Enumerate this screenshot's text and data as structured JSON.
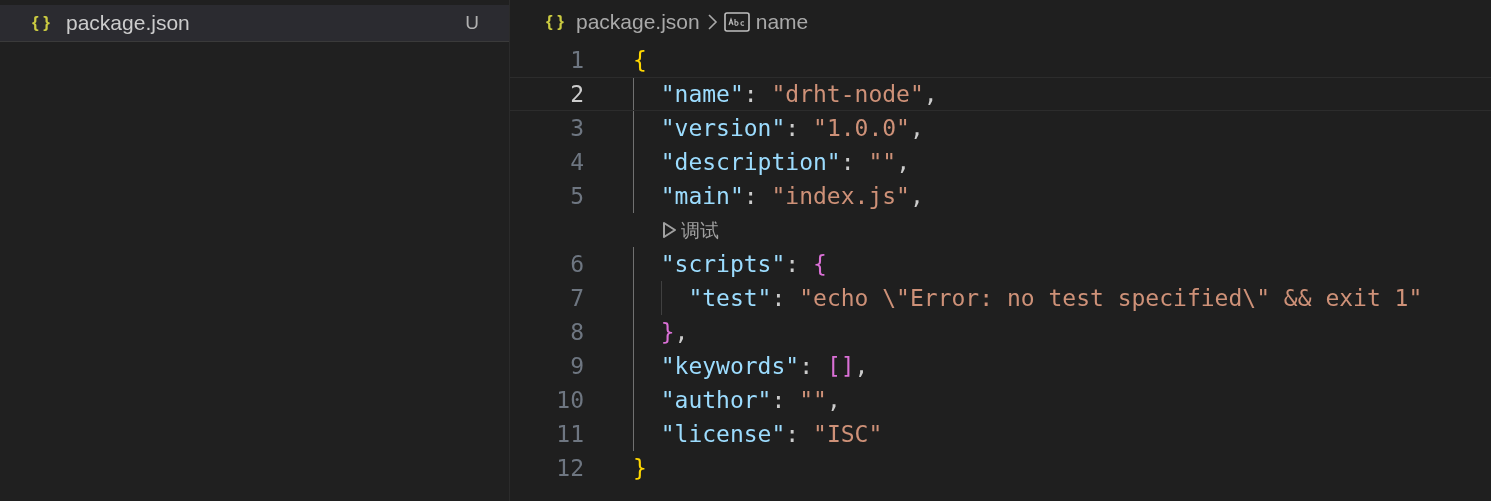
{
  "explorer": {
    "files": [
      {
        "icon": "{ }",
        "name": "package.json",
        "status": "U",
        "selected": true
      }
    ]
  },
  "breadcrumb": {
    "file_icon": "{ }",
    "file": "package.json",
    "symbol": "name"
  },
  "editor": {
    "lines": [
      {
        "kind": "code",
        "number": "1",
        "active": false,
        "tokens": [
          {
            "kind": "brace1",
            "text": "{"
          }
        ]
      },
      {
        "kind": "code",
        "number": "2",
        "active": true,
        "tokens": [
          {
            "kind": "key",
            "text": "  \"name\""
          },
          {
            "kind": "punct",
            "text": ": "
          },
          {
            "kind": "str",
            "text": "\"drht-node\""
          },
          {
            "kind": "punct",
            "text": ","
          }
        ]
      },
      {
        "kind": "code",
        "number": "3",
        "active": false,
        "tokens": [
          {
            "kind": "key",
            "text": "  \"version\""
          },
          {
            "kind": "punct",
            "text": ": "
          },
          {
            "kind": "str",
            "text": "\"1.0.0\""
          },
          {
            "kind": "punct",
            "text": ","
          }
        ]
      },
      {
        "kind": "code",
        "number": "4",
        "active": false,
        "tokens": [
          {
            "kind": "key",
            "text": "  \"description\""
          },
          {
            "kind": "punct",
            "text": ": "
          },
          {
            "kind": "str",
            "text": "\"\""
          },
          {
            "kind": "punct",
            "text": ","
          }
        ]
      },
      {
        "kind": "code",
        "number": "5",
        "active": false,
        "tokens": [
          {
            "kind": "key",
            "text": "  \"main\""
          },
          {
            "kind": "punct",
            "text": ": "
          },
          {
            "kind": "str",
            "text": "\"index.js\""
          },
          {
            "kind": "punct",
            "text": ","
          }
        ]
      },
      {
        "kind": "codelens",
        "label": "调试"
      },
      {
        "kind": "code",
        "number": "6",
        "active": false,
        "tokens": [
          {
            "kind": "key",
            "text": "  \"scripts\""
          },
          {
            "kind": "punct",
            "text": ": "
          },
          {
            "kind": "brace2",
            "text": "{"
          }
        ]
      },
      {
        "kind": "code",
        "number": "7",
        "active": false,
        "tokens": [
          {
            "kind": "key",
            "text": "    \"test\""
          },
          {
            "kind": "punct",
            "text": ": "
          },
          {
            "kind": "str",
            "text": "\"echo \\\"Error: no test specified\\\" && exit 1\""
          }
        ]
      },
      {
        "kind": "code",
        "number": "8",
        "active": false,
        "tokens": [
          {
            "kind": "brace2",
            "text": "  }"
          },
          {
            "kind": "punct",
            "text": ","
          }
        ]
      },
      {
        "kind": "code",
        "number": "9",
        "active": false,
        "tokens": [
          {
            "kind": "key",
            "text": "  \"keywords\""
          },
          {
            "kind": "punct",
            "text": ": "
          },
          {
            "kind": "brace2",
            "text": "[]"
          },
          {
            "kind": "punct",
            "text": ","
          }
        ]
      },
      {
        "kind": "code",
        "number": "10",
        "active": false,
        "tokens": [
          {
            "kind": "key",
            "text": "  \"author\""
          },
          {
            "kind": "punct",
            "text": ": "
          },
          {
            "kind": "str",
            "text": "\"\""
          },
          {
            "kind": "punct",
            "text": ","
          }
        ]
      },
      {
        "kind": "code",
        "number": "11",
        "active": false,
        "tokens": [
          {
            "kind": "key",
            "text": "  \"license\""
          },
          {
            "kind": "punct",
            "text": ": "
          },
          {
            "kind": "str",
            "text": "\"ISC\""
          }
        ]
      },
      {
        "kind": "code",
        "number": "12",
        "active": false,
        "tokens": [
          {
            "kind": "brace1",
            "text": "}"
          }
        ]
      }
    ]
  }
}
